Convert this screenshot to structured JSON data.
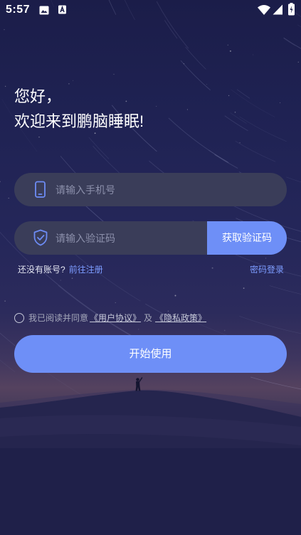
{
  "status_bar": {
    "time": "5:57",
    "notification_icons": [
      "image-icon",
      "text-a-icon"
    ],
    "system_icons": [
      "wifi-icon",
      "signal-icon",
      "battery-charging-icon"
    ]
  },
  "greeting": {
    "line1": "您好，",
    "line2": "欢迎来到鹏脑睡眠!"
  },
  "phone_input": {
    "icon": "phone-icon",
    "placeholder": "请输入手机号",
    "value": ""
  },
  "code_input": {
    "icon": "shield-check-icon",
    "placeholder": "请输入验证码",
    "value": ""
  },
  "get_code_button": {
    "label": "获取验证码"
  },
  "register": {
    "prompt": "还没有账号?",
    "link": "前往注册"
  },
  "password_login": {
    "label": "密码登录"
  },
  "agreement": {
    "checked": false,
    "prefix": "我已阅读并同意",
    "user_agreement": "《用户协议》",
    "conjunction": "及",
    "privacy_policy": "《隐私政策》"
  },
  "start_button": {
    "label": "开始使用"
  },
  "colors": {
    "accent": "#6e8ff7",
    "link": "#7c9cff",
    "field_background": "#3a3d59",
    "background": "#1f2049"
  }
}
